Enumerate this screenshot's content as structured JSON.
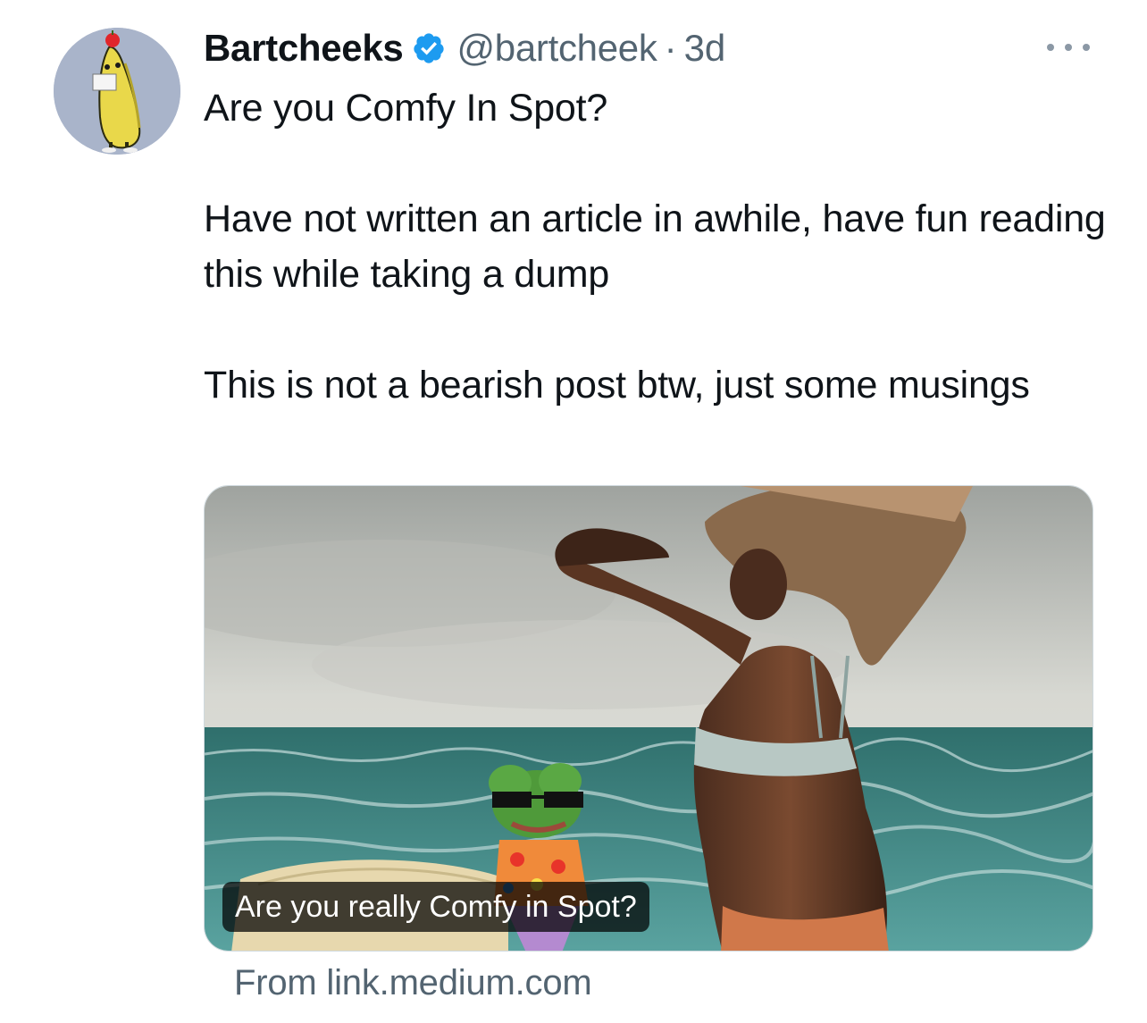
{
  "author": {
    "name": "Bartcheeks",
    "handle": "@bartcheek",
    "separator": "·",
    "time": "3d",
    "verified": true,
    "verified_color": "#1d9bf0"
  },
  "tweet": {
    "lines": [
      "Are you Comfy In Spot?",
      "Have not written an article in awhile, have fun reading this while taking a dump",
      "This is not a bearish post btw, just some musings"
    ]
  },
  "card": {
    "title": "Are you really Comfy in Spot?",
    "source": "From link.medium.com"
  },
  "icons": {
    "more": "more-horizontal-icon",
    "verified": "verified-badge-icon"
  }
}
